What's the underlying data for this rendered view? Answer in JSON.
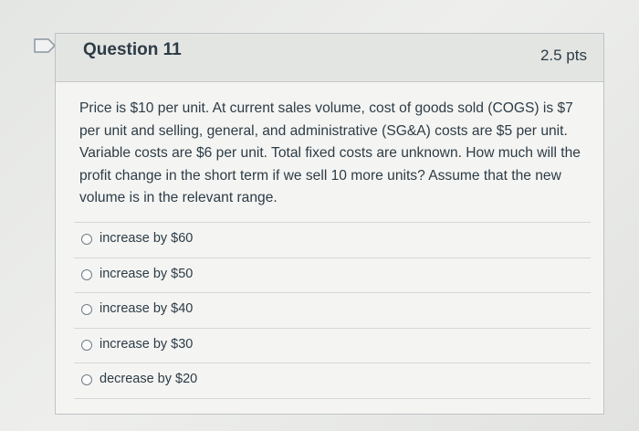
{
  "question": {
    "title": "Question 11",
    "points": "2.5 pts",
    "text": "Price is $10 per unit. At current sales volume, cost of goods sold (COGS) is $7 per unit and selling, general, and administrative (SG&A) costs are $5 per unit. Variable costs are $6 per unit. Total fixed costs are unknown. How much will the profit change in the short term if we sell 10 more units? Assume that the new volume is in the relevant range."
  },
  "answers": [
    {
      "label": "increase by $60"
    },
    {
      "label": "increase by $50"
    },
    {
      "label": "increase by $40"
    },
    {
      "label": "increase by $30"
    },
    {
      "label": "decrease by $20"
    }
  ],
  "colors": {
    "text": "#2d3b45",
    "header_bg": "#e3e5e3",
    "flag_outline": "#8a96a0"
  }
}
